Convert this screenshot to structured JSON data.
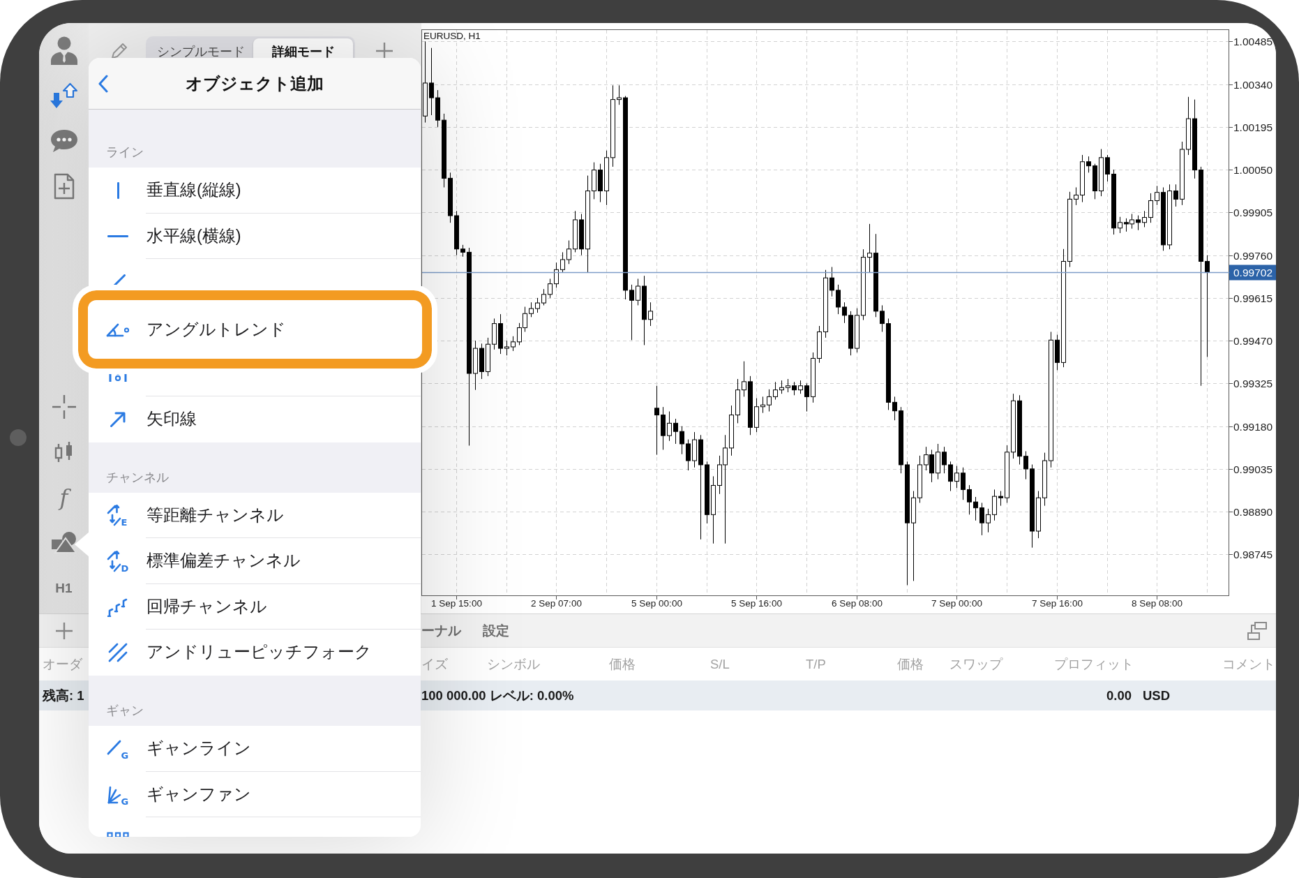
{
  "sidebar": {
    "indicator_label": "f",
    "timeframe_label": "H1"
  },
  "toolbar": {
    "modes": [
      {
        "label": "シンプルモード",
        "selected": false
      },
      {
        "label": "詳細モード",
        "selected": true
      }
    ]
  },
  "popover": {
    "title": "オブジェクト追加",
    "sections": [
      {
        "heading": "ライン",
        "items": [
          {
            "kind": "vertical",
            "label": "垂直線(縦線)",
            "highlighted": false
          },
          {
            "kind": "horizontal",
            "label": "水平線(横線)",
            "highlighted": false
          },
          {
            "kind": "trend",
            "highlighted": false
          },
          {
            "kind": "angle",
            "label": "アングルトレンド",
            "highlighted": true
          },
          {
            "kind": "cycle",
            "highlighted": false
          },
          {
            "kind": "arrow",
            "label": "矢印線",
            "highlighted": false
          }
        ]
      },
      {
        "heading": "チャンネル",
        "items": [
          {
            "kind": "equidistant",
            "label": "等距離チャンネル",
            "icon_letter": "E",
            "highlighted": false
          },
          {
            "kind": "stddev",
            "label": "標準偏差チャンネル",
            "icon_letter": "D",
            "highlighted": false
          },
          {
            "kind": "regression",
            "label": "回帰チャンネル",
            "highlighted": false
          },
          {
            "kind": "pitchfork",
            "label": "アンドリューピッチフォーク",
            "highlighted": false
          }
        ]
      },
      {
        "heading": "ギャン",
        "items": [
          {
            "kind": "gann-line",
            "label": "ギャンライン",
            "icon_letter": "G",
            "highlighted": false
          },
          {
            "kind": "gann-fan",
            "label": "ギャンファン",
            "icon_letter": "G",
            "highlighted": false
          },
          {
            "kind": "gann-grid",
            "highlighted": false
          }
        ]
      }
    ]
  },
  "chart": {
    "chart_data": {
      "type": "candlestick",
      "title": "EURUSD, H1",
      "grid": true,
      "categories": [
        null,
        null,
        null,
        null,
        null,
        "1 Sep 15:00",
        null,
        null,
        null,
        null,
        null,
        null,
        null,
        null,
        null,
        null,
        null,
        null,
        null,
        null,
        null,
        "2 Sep 07:00",
        null,
        null,
        null,
        null,
        null,
        null,
        null,
        null,
        null,
        null,
        null,
        null,
        null,
        null,
        null,
        "5 Sep 00:00",
        null,
        null,
        null,
        null,
        null,
        null,
        null,
        null,
        null,
        null,
        null,
        null,
        null,
        null,
        null,
        "5 Sep 16:00",
        null,
        null,
        null,
        null,
        null,
        null,
        null,
        null,
        null,
        null,
        null,
        null,
        null,
        null,
        null,
        "6 Sep 08:00",
        null,
        null,
        null,
        null,
        null,
        null,
        null,
        null,
        null,
        null,
        null,
        null,
        null,
        null,
        null,
        "7 Sep 00:00",
        null,
        null,
        null,
        null,
        null,
        null,
        null,
        null,
        null,
        null,
        null,
        null,
        null,
        null,
        null,
        "7 Sep 16:00",
        null,
        null,
        null,
        null,
        null,
        null,
        null,
        null,
        null,
        null,
        null,
        null,
        null,
        null,
        null,
        "8 Sep 08:00",
        null,
        null,
        null,
        null,
        null,
        null,
        null,
        null,
        null,
        null,
        null
      ],
      "ohlc": [
        [
          1.00232,
          1.00485,
          1.0021,
          1.00344
        ],
        [
          1.00344,
          1.00463,
          1.00235,
          1.00294
        ],
        [
          1.00294,
          1.0032,
          1.00195,
          1.00218
        ],
        [
          1.00218,
          1.0024,
          0.9999,
          1.00021
        ],
        [
          1.00021,
          1.0004,
          0.9987,
          0.99894
        ],
        [
          0.99894,
          0.9991,
          0.9976,
          0.99781
        ],
        [
          0.99781,
          0.99795,
          0.99755,
          0.9977
        ],
        [
          0.9977,
          0.99785,
          0.99114,
          0.99359
        ],
        [
          0.99359,
          0.9947,
          0.99303,
          0.99444
        ],
        [
          0.99444,
          0.9946,
          0.9934,
          0.99365
        ],
        [
          0.99365,
          0.9948,
          0.9935,
          0.99458
        ],
        [
          0.99458,
          0.99545,
          0.9944,
          0.99528
        ],
        [
          0.99528,
          0.9956,
          0.99425,
          0.99444
        ],
        [
          0.99444,
          0.9947,
          0.9942,
          0.99449
        ],
        [
          0.99449,
          0.99485,
          0.99435,
          0.99466
        ],
        [
          0.99466,
          0.9953,
          0.99455,
          0.99514
        ],
        [
          0.99514,
          0.99585,
          0.995,
          0.99562
        ],
        [
          0.99562,
          0.996,
          0.9955,
          0.99579
        ],
        [
          0.99579,
          0.99615,
          0.99565,
          0.99598
        ],
        [
          0.99598,
          0.99645,
          0.9959,
          0.99627
        ],
        [
          0.99627,
          0.9968,
          0.99615,
          0.99663
        ],
        [
          0.99663,
          0.99735,
          0.9965,
          0.99711
        ],
        [
          0.99711,
          0.9977,
          0.997,
          0.99745
        ],
        [
          0.99745,
          0.9981,
          0.9973,
          0.99781
        ],
        [
          0.99781,
          0.9991,
          0.9977,
          0.9988
        ],
        [
          0.9988,
          0.999,
          0.9976,
          0.99781
        ],
        [
          0.99781,
          1.0003,
          0.997,
          0.99978
        ],
        [
          0.99978,
          1.00075,
          0.9995,
          1.00049
        ],
        [
          1.00049,
          1.0007,
          0.9994,
          0.99978
        ],
        [
          0.99978,
          1.00115,
          0.9993,
          1.00091
        ],
        [
          1.00091,
          1.00336,
          1.0006,
          1.00288
        ],
        [
          1.00288,
          1.00336,
          1.0027,
          1.00294
        ],
        [
          1.00294,
          1.003,
          0.9961,
          0.99641
        ],
        [
          0.99641,
          0.9966,
          0.99472,
          0.99607
        ],
        [
          0.99607,
          0.9968,
          0.9959,
          0.99655
        ],
        [
          0.99655,
          0.9969,
          0.99455,
          0.99542
        ],
        [
          0.99542,
          0.996,
          0.9952,
          0.9957
        ],
        [
          0.99241,
          0.99317,
          0.99083,
          0.99218
        ],
        [
          0.99218,
          0.99245,
          0.991,
          0.99148
        ],
        [
          0.99148,
          0.9923,
          0.9913,
          0.9919
        ],
        [
          0.9919,
          0.99205,
          0.9912,
          0.99162
        ],
        [
          0.99162,
          0.9918,
          0.99085,
          0.9912
        ],
        [
          0.9912,
          0.99135,
          0.9903,
          0.99063
        ],
        [
          0.99063,
          0.9916,
          0.9904,
          0.99134
        ],
        [
          0.99134,
          0.9915,
          0.98796,
          0.99049
        ],
        [
          0.99049,
          0.9906,
          0.9885,
          0.9888
        ],
        [
          0.9888,
          0.9901,
          0.98782,
          0.98979
        ],
        [
          0.98979,
          0.9908,
          0.9895,
          0.99049
        ],
        [
          0.99049,
          0.9915,
          0.98782,
          0.99106
        ],
        [
          0.99106,
          0.9925,
          0.9908,
          0.99218
        ],
        [
          0.99218,
          0.9934,
          0.9919,
          0.99303
        ],
        [
          0.99303,
          0.994,
          0.9928,
          0.99331
        ],
        [
          0.99331,
          0.9935,
          0.9915,
          0.99176
        ],
        [
          0.99176,
          0.99275,
          0.9916,
          0.99246
        ],
        [
          0.99246,
          0.9928,
          0.99225,
          0.99252
        ],
        [
          0.99252,
          0.99305,
          0.9923,
          0.9928
        ],
        [
          0.9928,
          0.9933,
          0.9927,
          0.99303
        ],
        [
          0.99303,
          0.99335,
          0.9929,
          0.99311
        ],
        [
          0.99311,
          0.9934,
          0.99295,
          0.99317
        ],
        [
          0.99317,
          0.9933,
          0.99285,
          0.99303
        ],
        [
          0.99303,
          0.99335,
          0.9929,
          0.99317
        ],
        [
          0.99317,
          0.99325,
          0.9923,
          0.9928
        ],
        [
          0.9928,
          0.9943,
          0.9926,
          0.9941
        ],
        [
          0.9941,
          0.9952,
          0.99395,
          0.995
        ],
        [
          0.995,
          0.9971,
          0.9948,
          0.99683
        ],
        [
          0.99683,
          0.9972,
          0.9962,
          0.99641
        ],
        [
          0.99641,
          0.9966,
          0.9956,
          0.99584
        ],
        [
          0.99584,
          0.996,
          0.9953,
          0.99556
        ],
        [
          0.99556,
          0.9957,
          0.9942,
          0.99444
        ],
        [
          0.99444,
          0.9958,
          0.9943,
          0.99556
        ],
        [
          0.99556,
          0.9978,
          0.9954,
          0.99753
        ],
        [
          0.99753,
          0.99866,
          0.997,
          0.99767
        ],
        [
          0.99767,
          0.99832,
          0.9955,
          0.9957
        ],
        [
          0.9957,
          0.9959,
          0.995,
          0.99528
        ],
        [
          0.99528,
          0.99545,
          0.99235,
          0.99261
        ],
        [
          0.99261,
          0.9928,
          0.992,
          0.99232
        ],
        [
          0.99232,
          0.99245,
          0.9902,
          0.99049
        ],
        [
          0.99049,
          0.9906,
          0.98641,
          0.98852
        ],
        [
          0.98852,
          0.9896,
          0.98655,
          0.98937
        ],
        [
          0.98937,
          0.9908,
          0.9892,
          0.99049
        ],
        [
          0.99049,
          0.9911,
          0.9903,
          0.99083
        ],
        [
          0.99083,
          0.991,
          0.9899,
          0.99021
        ],
        [
          0.99021,
          0.9912,
          0.99,
          0.99092
        ],
        [
          0.99092,
          0.9911,
          0.9902,
          0.99049
        ],
        [
          0.99049,
          0.9906,
          0.9896,
          0.98993
        ],
        [
          0.98993,
          0.99045,
          0.9897,
          0.99021
        ],
        [
          0.99021,
          0.9904,
          0.9893,
          0.98965
        ],
        [
          0.98965,
          0.9898,
          0.9888,
          0.98923
        ],
        [
          0.98923,
          0.9894,
          0.9886,
          0.98903
        ],
        [
          0.98903,
          0.9892,
          0.9881,
          0.98852
        ],
        [
          0.98852,
          0.989,
          0.9882,
          0.9888
        ],
        [
          0.9888,
          0.98965,
          0.9886,
          0.98942
        ],
        [
          0.98942,
          0.9896,
          0.9891,
          0.98937
        ],
        [
          0.98937,
          0.99115,
          0.9892,
          0.99092
        ],
        [
          0.99092,
          0.9929,
          0.9907,
          0.99266
        ],
        [
          0.99266,
          0.99285,
          0.9905,
          0.99078
        ],
        [
          0.99078,
          0.99095,
          0.99,
          0.99035
        ],
        [
          0.99035,
          0.9905,
          0.98768,
          0.98824
        ],
        [
          0.98824,
          0.9896,
          0.988,
          0.98937
        ],
        [
          0.98937,
          0.9909,
          0.9891,
          0.99063
        ],
        [
          0.99063,
          0.995,
          0.9904,
          0.99472
        ],
        [
          0.99472,
          0.9949,
          0.9937,
          0.99396
        ],
        [
          0.99396,
          0.99781,
          0.9938,
          0.99739
        ],
        [
          0.99739,
          0.99975,
          0.9972,
          0.9995
        ],
        [
          0.9995,
          0.9999,
          0.9993,
          0.99964
        ],
        [
          0.99964,
          1.001,
          0.9994,
          1.00077
        ],
        [
          1.00077,
          1.00095,
          1.0004,
          1.00063
        ],
        [
          1.00063,
          1.0007,
          0.9995,
          0.99978
        ],
        [
          0.99978,
          1.0012,
          0.9996,
          1.00091
        ],
        [
          1.00091,
          1.001,
          1.0001,
          1.00035
        ],
        [
          1.00035,
          1.0005,
          0.9983,
          0.99852
        ],
        [
          0.99852,
          0.9989,
          0.99835,
          0.99871
        ],
        [
          0.99871,
          0.99885,
          0.9984,
          0.99866
        ],
        [
          0.99866,
          0.999,
          0.9985,
          0.9988
        ],
        [
          0.9988,
          0.99895,
          0.99845,
          0.99871
        ],
        [
          0.99871,
          0.9991,
          0.99855,
          0.99888
        ],
        [
          0.99888,
          0.9997,
          0.9987,
          0.99945
        ],
        [
          0.99945,
          0.99995,
          0.9993,
          0.99973
        ],
        [
          0.99973,
          0.9999,
          0.99775,
          0.99795
        ],
        [
          0.99795,
          1.0,
          0.9978,
          0.99978
        ],
        [
          0.99978,
          1.0,
          0.99925,
          0.9995
        ],
        [
          0.9995,
          1.00145,
          0.9993,
          1.00119
        ],
        [
          1.00119,
          1.00297,
          1.001,
          1.00223
        ],
        [
          1.00223,
          1.00288,
          1.0002,
          1.00049
        ],
        [
          1.00049,
          1.0006,
          0.99317,
          0.99739
        ],
        [
          0.99739,
          0.9976,
          0.99415,
          0.99702
        ],
        null,
        null,
        null
      ],
      "ylim": [
        0.98605,
        1.00525
      ],
      "yticks": [
        {
          "value": 1.00485,
          "label": "1.00485"
        },
        {
          "value": 1.0034,
          "label": "1.00340"
        },
        {
          "value": 1.00195,
          "label": "1.00195"
        },
        {
          "value": 1.0005,
          "label": "1.00050"
        },
        {
          "value": 0.99905,
          "label": "0.99905"
        },
        {
          "value": 0.9976,
          "label": "0.99760"
        },
        {
          "value": 0.99615,
          "label": "0.99615"
        },
        {
          "value": 0.9947,
          "label": "0.99470"
        },
        {
          "value": 0.99325,
          "label": "0.99325"
        },
        {
          "value": 0.9918,
          "label": "0.99180"
        },
        {
          "value": 0.99035,
          "label": "0.99035"
        },
        {
          "value": 0.9889,
          "label": "0.98890"
        },
        {
          "value": 0.98745,
          "label": "0.98745"
        }
      ],
      "ref_lines": [
        {
          "axis": "y",
          "value": 0.99702,
          "label": "0.99702"
        }
      ]
    }
  },
  "bottom_panel": {
    "tabs": [
      {
        "label": "ーナル",
        "selected": false
      },
      {
        "label": "設定",
        "selected": false
      }
    ],
    "columns": [
      "オーダ",
      "イズ",
      "シンボル",
      "価格",
      "S/L",
      "T/P",
      "価格",
      "スワップ",
      "プロフィット",
      "コメント"
    ],
    "balance_row": [
      "残高: 1",
      "100 000.00 レベル: 0.00%",
      "0.00",
      "USD"
    ]
  }
}
